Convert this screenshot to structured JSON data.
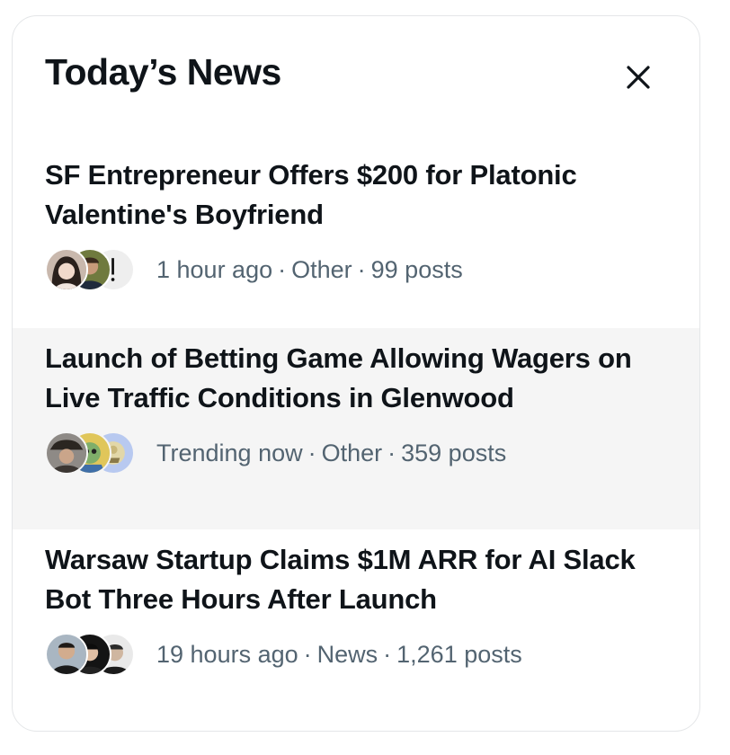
{
  "header": {
    "title": "Today’s News",
    "close_icon": "close-icon"
  },
  "colors": {
    "title_text": "#0f1419",
    "meta_text": "#536471",
    "hover_row": "#f5f5f5",
    "card_border": "#e4e6e8"
  },
  "news": [
    {
      "headline": "SF Entrepreneur Offers $200 for Platonic Valentine's Boyfriend",
      "time": "1 hour ago",
      "category": "Other",
      "posts": "99 posts",
      "separator": "·"
    },
    {
      "headline": "Launch of Betting Game Allowing Wagers on Live Traffic Conditions in Glenwood",
      "time": "Trending now",
      "category": "Other",
      "posts": "359 posts",
      "separator": "·"
    },
    {
      "headline": "Warsaw Startup Claims $1M ARR for AI Slack Bot Three Hours After Launch",
      "time": "19 hours ago",
      "category": "News",
      "posts": "1,261 posts",
      "separator": "·"
    }
  ]
}
